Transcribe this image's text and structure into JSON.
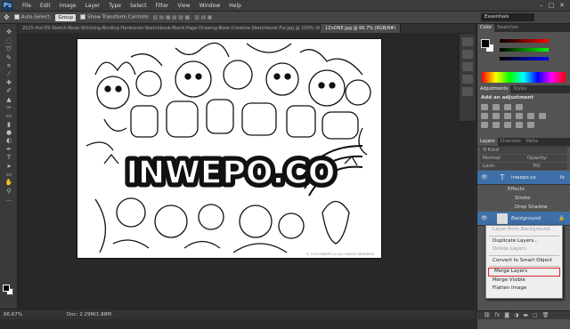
{
  "menu": {
    "logo": "Ps",
    "items": [
      "File",
      "Edit",
      "Image",
      "Layer",
      "Type",
      "Select",
      "Filter",
      "View",
      "Window",
      "Help"
    ]
  },
  "options": {
    "auto_select_label": "Auto-Select:",
    "auto_select_value": "Group",
    "show_transform_label": "Show Transform Controls",
    "workspace": "Essentials"
  },
  "tabs": [
    {
      "label": "2015-Hot-ES-Sketch-Book-Stitching-Binding-Hardcover-Sketchbook-Blank-Page-Drawing-Book-Creative-Sketchbook-For.jpg @ 100% (RGB/8#)",
      "active": false
    },
    {
      "label": "1ZnONE.jpg @ 66.7% (RGB/8#)",
      "active": true
    }
  ],
  "status": {
    "zoom": "66.67%",
    "doc": "Doc: 2.29M/1.88M"
  },
  "panels": {
    "color_tabs": [
      "Color",
      "Swatches"
    ],
    "adjust_tabs": [
      "Adjustments",
      "Styles"
    ],
    "add_adjustment": "Add an adjustment",
    "layers_tabs": [
      "Layers",
      "Channels",
      "Paths"
    ],
    "kind_label": "Kind",
    "blend_mode": "Normal",
    "opacity_label": "Opacity:",
    "lock_label": "Lock:",
    "fill_label": "Fill:",
    "layer1_name": "inwepo.co",
    "layer1_fx": "fx",
    "effects_label": "Effects",
    "effect_stroke": "Stroke",
    "effect_shadow": "Drop Shadow",
    "layer2_name": "Background"
  },
  "context_menu": {
    "items": [
      {
        "label": "Layer from Background...",
        "disabled": true
      },
      {
        "sep": true
      },
      {
        "label": "Duplicate Layers...",
        "disabled": false
      },
      {
        "label": "Delete Layers",
        "disabled": true
      },
      {
        "sep": true
      },
      {
        "label": "Convert to Smart Object",
        "disabled": false
      },
      {
        "sep": true
      },
      {
        "label": "Merge Layers",
        "disabled": false,
        "highlight": true
      },
      {
        "label": "Merge Visible",
        "disabled": false
      },
      {
        "label": "Flatten Image",
        "disabled": false
      }
    ]
  },
  "canvas": {
    "word": "INWEPO.CO",
    "credit": "© 2015 INWEPO.CO ALL RIGHTS RESERVED"
  },
  "colors": {
    "highlight": "#e0242a",
    "selected_layer": "#3e6fa8"
  }
}
